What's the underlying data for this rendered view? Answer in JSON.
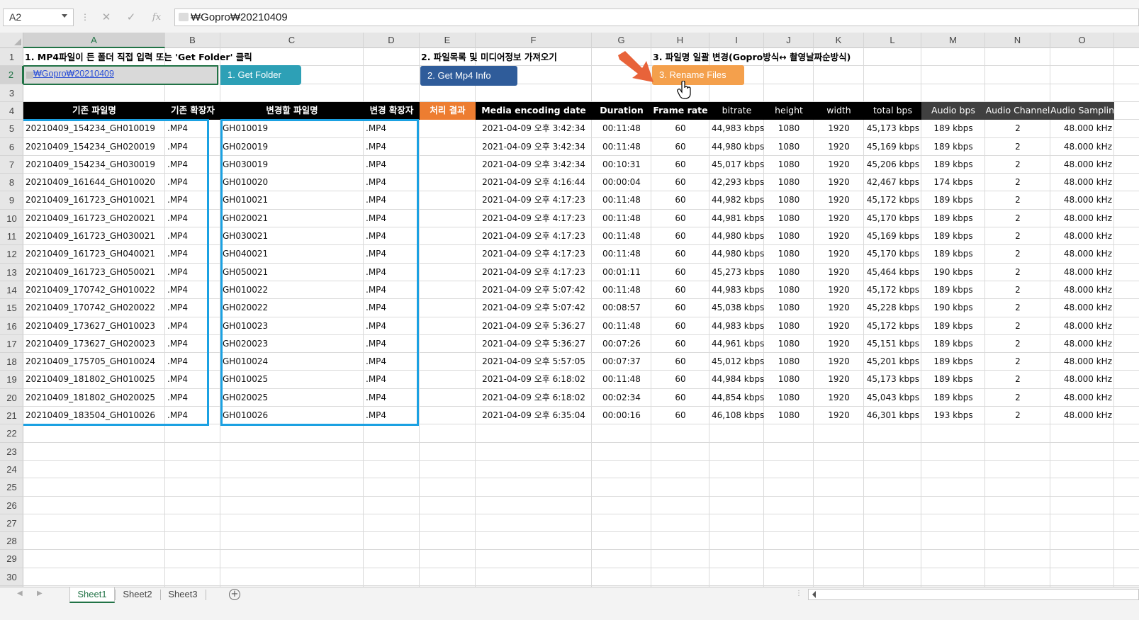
{
  "formula_bar": {
    "name_box": "A2",
    "cancel_icon": "✕",
    "enter_icon": "✓",
    "fx_icon": "fx",
    "formula_value": "₩Gopro₩20210409"
  },
  "columns": [
    "A",
    "B",
    "C",
    "D",
    "E",
    "F",
    "G",
    "H",
    "I",
    "J",
    "K",
    "L",
    "M",
    "N",
    "O"
  ],
  "rows": [
    "1",
    "2",
    "3",
    "4",
    "5",
    "6",
    "7",
    "8",
    "9",
    "10",
    "11",
    "12",
    "13",
    "14",
    "15",
    "16",
    "17",
    "18",
    "19",
    "20",
    "21",
    "22",
    "23",
    "24",
    "25",
    "26",
    "27",
    "28",
    "29",
    "30"
  ],
  "sheet": {
    "title1": "1. MP4파일이 든 폴더 직접 입력 또는 'Get Folder' 클릭",
    "title2": "2. 파일목록 및 미디어정보 가져오기",
    "title3": "3. 파일명 일괄 변경(Gopro방식↔ 촬영날짜순방식)",
    "a2_value": "₩Gopro₩20210409",
    "btn_get_folder": "1. Get Folder",
    "btn_get_info": "2. Get Mp4 Info",
    "btn_rename": "3. Rename Files",
    "headers": [
      "기존 파일명",
      "기존 확장자",
      "변경할 파일명",
      "변경 확장자",
      "처리 결과",
      "Media encoding date",
      "Duration",
      "Frame rate",
      "bitrate",
      "height",
      "width",
      "total bps",
      "Audio bps",
      "Audio Channel",
      "Audio Sampling"
    ]
  },
  "table_rows": [
    [
      "20210409_154234_GH010019",
      ".MP4",
      "GH010019",
      ".MP4",
      "",
      "2021-04-09 오후 3:42:34",
      "00:11:48",
      "60",
      "44,983 kbps",
      "1080",
      "1920",
      "45,173 kbps",
      "189 kbps",
      "2",
      "48.000 kHz"
    ],
    [
      "20210409_154234_GH020019",
      ".MP4",
      "GH020019",
      ".MP4",
      "",
      "2021-04-09 오후 3:42:34",
      "00:11:48",
      "60",
      "44,980 kbps",
      "1080",
      "1920",
      "45,169 kbps",
      "189 kbps",
      "2",
      "48.000 kHz"
    ],
    [
      "20210409_154234_GH030019",
      ".MP4",
      "GH030019",
      ".MP4",
      "",
      "2021-04-09 오후 3:42:34",
      "00:10:31",
      "60",
      "45,017 kbps",
      "1080",
      "1920",
      "45,206 kbps",
      "189 kbps",
      "2",
      "48.000 kHz"
    ],
    [
      "20210409_161644_GH010020",
      ".MP4",
      "GH010020",
      ".MP4",
      "",
      "2021-04-09 오후 4:16:44",
      "00:00:04",
      "60",
      "42,293 kbps",
      "1080",
      "1920",
      "42,467 kbps",
      "174 kbps",
      "2",
      "48.000 kHz"
    ],
    [
      "20210409_161723_GH010021",
      ".MP4",
      "GH010021",
      ".MP4",
      "",
      "2021-04-09 오후 4:17:23",
      "00:11:48",
      "60",
      "44,982 kbps",
      "1080",
      "1920",
      "45,172 kbps",
      "189 kbps",
      "2",
      "48.000 kHz"
    ],
    [
      "20210409_161723_GH020021",
      ".MP4",
      "GH020021",
      ".MP4",
      "",
      "2021-04-09 오후 4:17:23",
      "00:11:48",
      "60",
      "44,981 kbps",
      "1080",
      "1920",
      "45,170 kbps",
      "189 kbps",
      "2",
      "48.000 kHz"
    ],
    [
      "20210409_161723_GH030021",
      ".MP4",
      "GH030021",
      ".MP4",
      "",
      "2021-04-09 오후 4:17:23",
      "00:11:48",
      "60",
      "44,980 kbps",
      "1080",
      "1920",
      "45,169 kbps",
      "189 kbps",
      "2",
      "48.000 kHz"
    ],
    [
      "20210409_161723_GH040021",
      ".MP4",
      "GH040021",
      ".MP4",
      "",
      "2021-04-09 오후 4:17:23",
      "00:11:48",
      "60",
      "44,980 kbps",
      "1080",
      "1920",
      "45,170 kbps",
      "189 kbps",
      "2",
      "48.000 kHz"
    ],
    [
      "20210409_161723_GH050021",
      ".MP4",
      "GH050021",
      ".MP4",
      "",
      "2021-04-09 오후 4:17:23",
      "00:01:11",
      "60",
      "45,273 kbps",
      "1080",
      "1920",
      "45,464 kbps",
      "190 kbps",
      "2",
      "48.000 kHz"
    ],
    [
      "20210409_170742_GH010022",
      ".MP4",
      "GH010022",
      ".MP4",
      "",
      "2021-04-09 오후 5:07:42",
      "00:11:48",
      "60",
      "44,983 kbps",
      "1080",
      "1920",
      "45,172 kbps",
      "189 kbps",
      "2",
      "48.000 kHz"
    ],
    [
      "20210409_170742_GH020022",
      ".MP4",
      "GH020022",
      ".MP4",
      "",
      "2021-04-09 오후 5:07:42",
      "00:08:57",
      "60",
      "45,038 kbps",
      "1080",
      "1920",
      "45,228 kbps",
      "190 kbps",
      "2",
      "48.000 kHz"
    ],
    [
      "20210409_173627_GH010023",
      ".MP4",
      "GH010023",
      ".MP4",
      "",
      "2021-04-09 오후 5:36:27",
      "00:11:48",
      "60",
      "44,983 kbps",
      "1080",
      "1920",
      "45,172 kbps",
      "189 kbps",
      "2",
      "48.000 kHz"
    ],
    [
      "20210409_173627_GH020023",
      ".MP4",
      "GH020023",
      ".MP4",
      "",
      "2021-04-09 오후 5:36:27",
      "00:07:26",
      "60",
      "44,961 kbps",
      "1080",
      "1920",
      "45,151 kbps",
      "189 kbps",
      "2",
      "48.000 kHz"
    ],
    [
      "20210409_175705_GH010024",
      ".MP4",
      "GH010024",
      ".MP4",
      "",
      "2021-04-09 오후 5:57:05",
      "00:07:37",
      "60",
      "45,012 kbps",
      "1080",
      "1920",
      "45,201 kbps",
      "189 kbps",
      "2",
      "48.000 kHz"
    ],
    [
      "20210409_181802_GH010025",
      ".MP4",
      "GH010025",
      ".MP4",
      "",
      "2021-04-09 오후 6:18:02",
      "00:11:48",
      "60",
      "44,984 kbps",
      "1080",
      "1920",
      "45,173 kbps",
      "189 kbps",
      "2",
      "48.000 kHz"
    ],
    [
      "20210409_181802_GH020025",
      ".MP4",
      "GH020025",
      ".MP4",
      "",
      "2021-04-09 오후 6:18:02",
      "00:02:34",
      "60",
      "44,854 kbps",
      "1080",
      "1920",
      "45,043 kbps",
      "189 kbps",
      "2",
      "48.000 kHz"
    ],
    [
      "20210409_183504_GH010026",
      ".MP4",
      "GH010026",
      ".MP4",
      "",
      "2021-04-09 오후 6:35:04",
      "00:00:16",
      "60",
      "46,108 kbps",
      "1080",
      "1920",
      "46,301 kbps",
      "193 kbps",
      "2",
      "48.000 kHz"
    ]
  ],
  "sheet_tabs": [
    "Sheet1",
    "Sheet2",
    "Sheet3"
  ],
  "active_tab": "Sheet1",
  "add_sheet_label": "+",
  "colors": {
    "accent": "#217346",
    "selection_box": "#1ba1e2",
    "btn_get_folder": "#2da0b6",
    "btn_get_info": "#2f5c9a",
    "btn_rename": "#f4a04c",
    "status_header": "#ed7d31",
    "arrow": "#e8633a"
  },
  "icons": {
    "arrow": "down-right-arrow-icon",
    "cursor": "hand-cursor-icon"
  }
}
